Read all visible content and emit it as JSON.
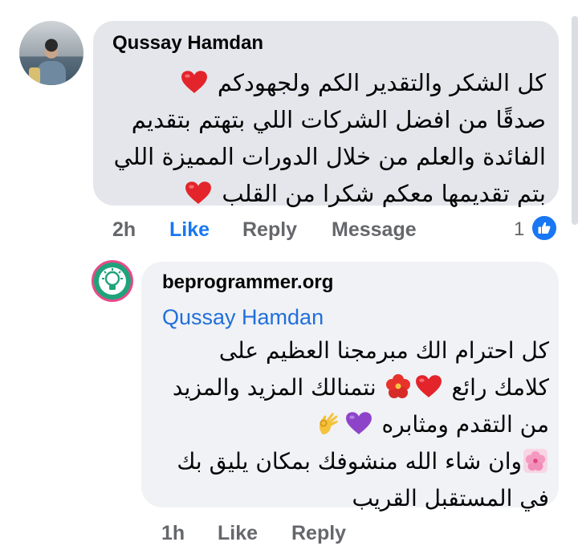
{
  "comment": {
    "author": "Qussay Hamdan",
    "lines": [
      "كل الشكر والتقدير الكم ولجهودكم",
      "صدقًا من افضل الشركات اللي بتهتم بتقديم",
      "الفائدة والعلم من خلال الدورات المميزة اللي",
      "بتم تقديمها معكم شكرا من القلب"
    ],
    "time": "2h",
    "like_label": "Like",
    "reply_label": "Reply",
    "message_label": "Message",
    "reaction_count": "1"
  },
  "reply": {
    "author": "beprogrammer.org",
    "mention": "Qussay Hamdan",
    "lines": [
      "كل احترام الك مبرمجنا العظيم على",
      "كلامك رائع",
      "نتمنالك المزيد والمزيد",
      "من التقدم ومثابره",
      "وان شاء الله منشوفك بمكان يليق بك",
      "في المستقبل القريب"
    ],
    "time": "1h",
    "like_label": "Like",
    "reply_label": "Reply"
  },
  "colors": {
    "bubble_primary": "#e4e6eb",
    "bubble_reply": "#f0f2f5",
    "like_active": "#1877f2",
    "mention": "#216fdb",
    "muted": "#65676b",
    "heart": "#e3242b",
    "purple_heart": "#8e44c9"
  },
  "icons": [
    "heart-icon",
    "hibiscus-icon",
    "purple-heart-icon",
    "ok-hand-icon",
    "cherry-blossom-icon",
    "like-thumb-icon"
  ]
}
